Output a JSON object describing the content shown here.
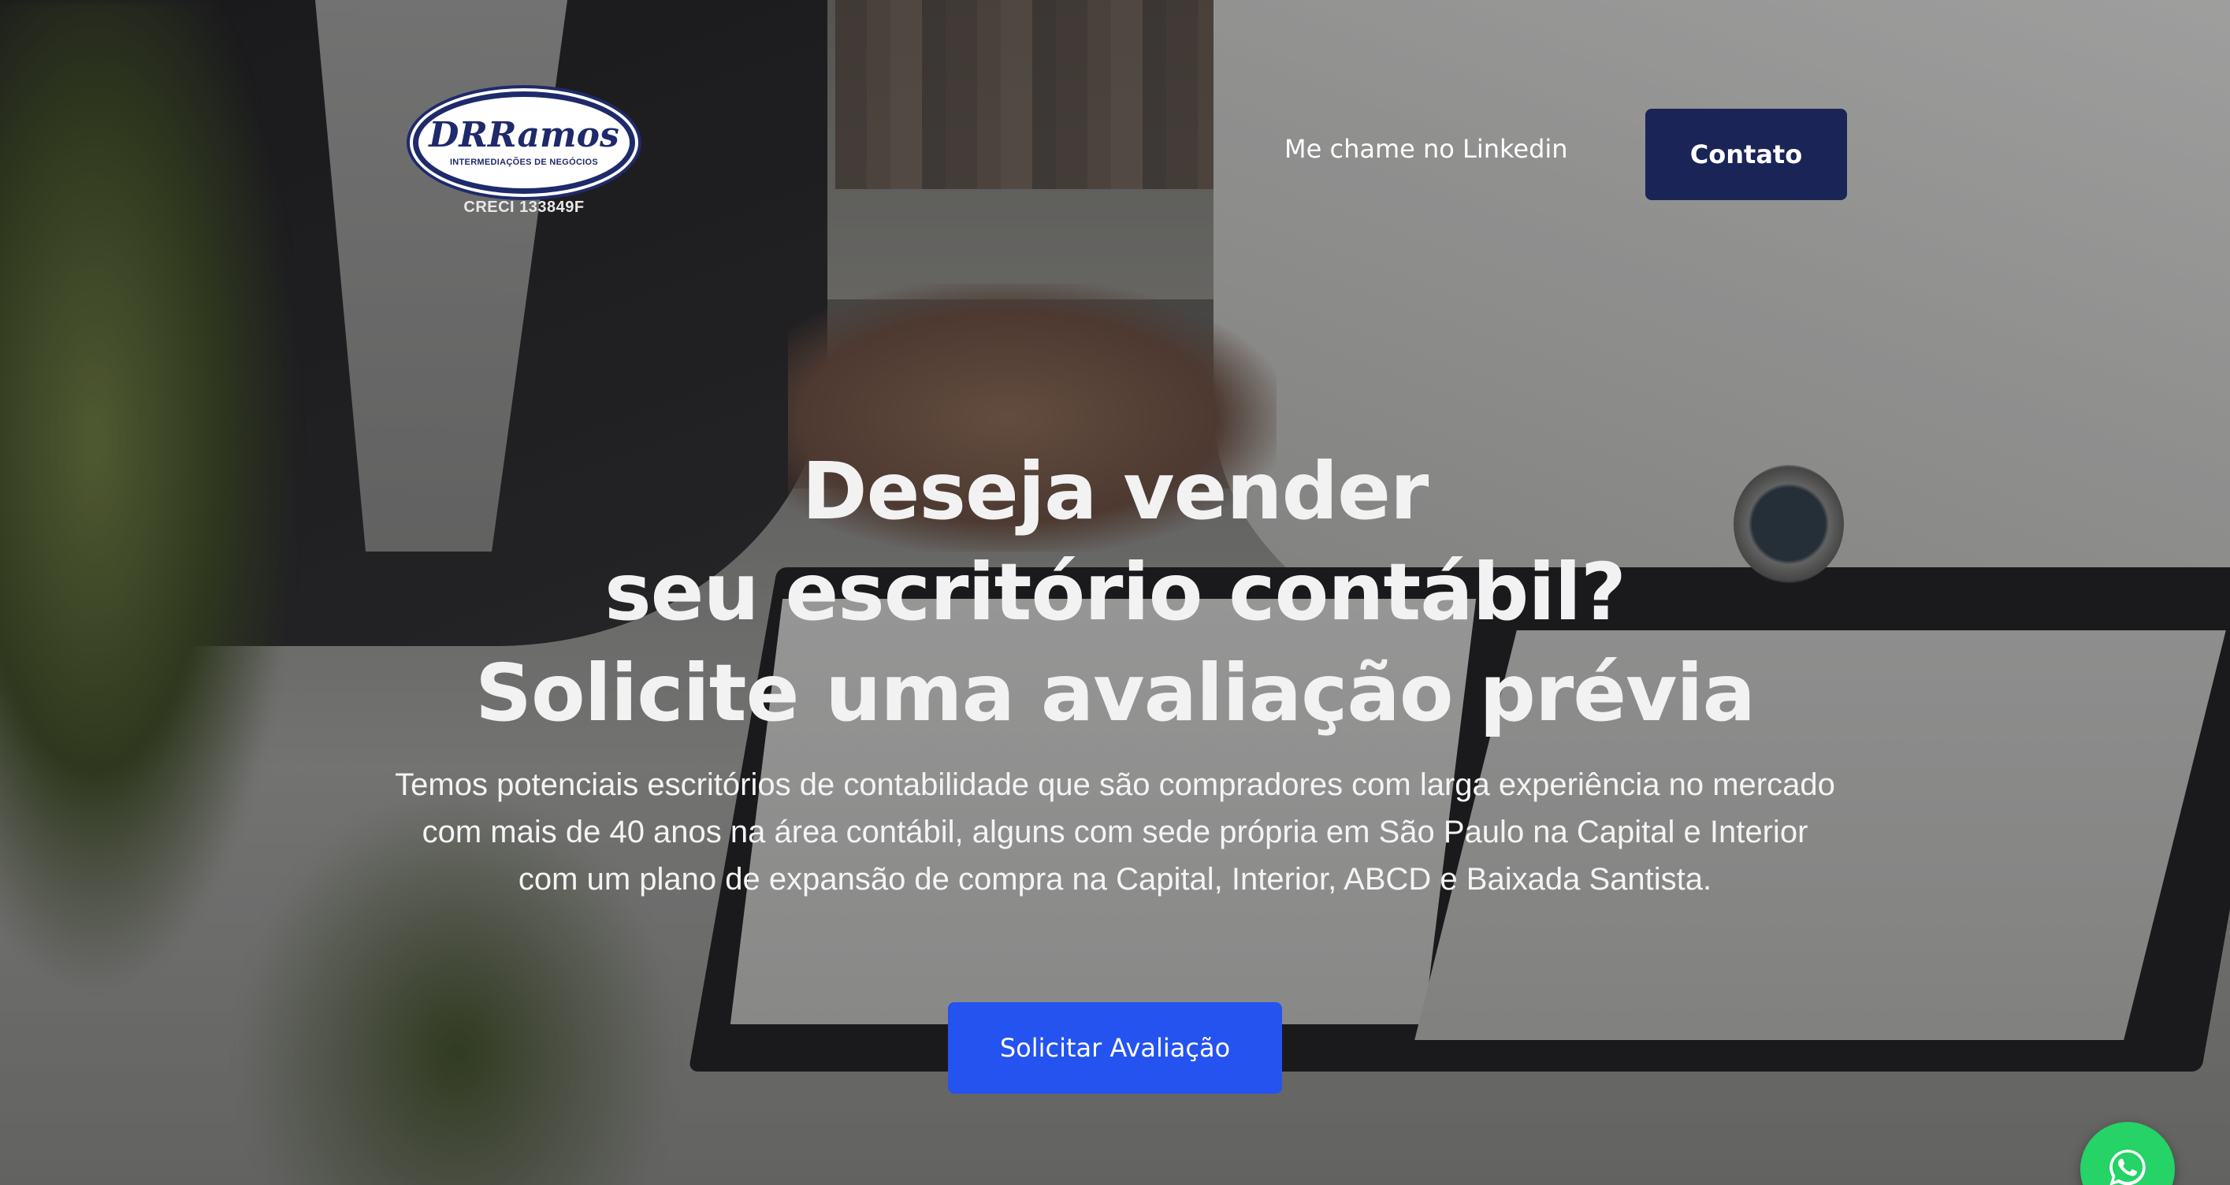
{
  "header": {
    "logo": {
      "name": "DRRamos",
      "subtitle": "INTERMEDIAÇÕES DE NEGÓCIOS",
      "creci": "CRECI 133849F"
    },
    "nav_link_label": "Me chame no Linkedin",
    "contact_button_label": "Contato"
  },
  "hero": {
    "title_lines": [
      "Deseja vender",
      "seu escritório contábil?",
      "Solicite uma avaliação prévia"
    ],
    "description": "Temos potenciais escritórios de contabilidade que são compradores com larga experiência no mercado com mais de 40 anos na área contábil, alguns com sede própria em São Paulo na Capital e Interior com um plano de expansão de compra na Capital, Interior, ABCD e Baixada Santista.",
    "cta_label": "Solicitar Avaliação"
  },
  "floating": {
    "whatsapp_icon": "whatsapp-icon"
  },
  "colors": {
    "contact_button": "#1a2456",
    "cta_button": "#2453f0",
    "whatsapp": "#25d366",
    "logo_navy": "#1f2a6b"
  }
}
